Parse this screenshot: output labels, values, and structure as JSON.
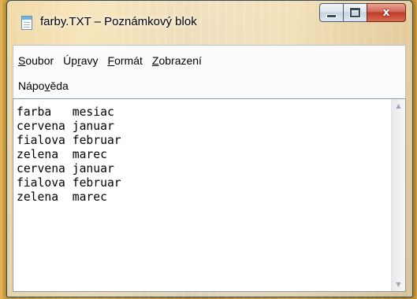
{
  "window": {
    "title": "farby.TXT – Poznámkový blok",
    "app_icon": "notepad-icon",
    "caption_icons": [
      "minimize-icon",
      "maximize-icon",
      "close-icon"
    ],
    "close_glyph": "x"
  },
  "menu": {
    "items": [
      {
        "pre": "",
        "accel": "S",
        "post": "oubor"
      },
      {
        "pre": "Úp",
        "accel": "r",
        "post": "avy"
      },
      {
        "pre": "",
        "accel": "F",
        "post": "ormát"
      },
      {
        "pre": "",
        "accel": "Z",
        "post": "obrazení"
      },
      {
        "pre": "Nápo",
        "accel": "v",
        "post": "ěda"
      }
    ]
  },
  "editor": {
    "content": "farba   mesiac\ncervena januar\nfialova februar\nzelena  marec\ncervena januar\nfialova februar\nzelena  marec"
  },
  "scrollbar": {
    "up_icon": "scroll-up-arrow-icon",
    "down_icon": "scroll-down-arrow-icon",
    "up_glyph": "▲",
    "down_glyph": "▼"
  },
  "colors": {
    "desktop": "#e0b04f",
    "close_button": "#c8462f",
    "editor_bg": "#ffffff"
  }
}
